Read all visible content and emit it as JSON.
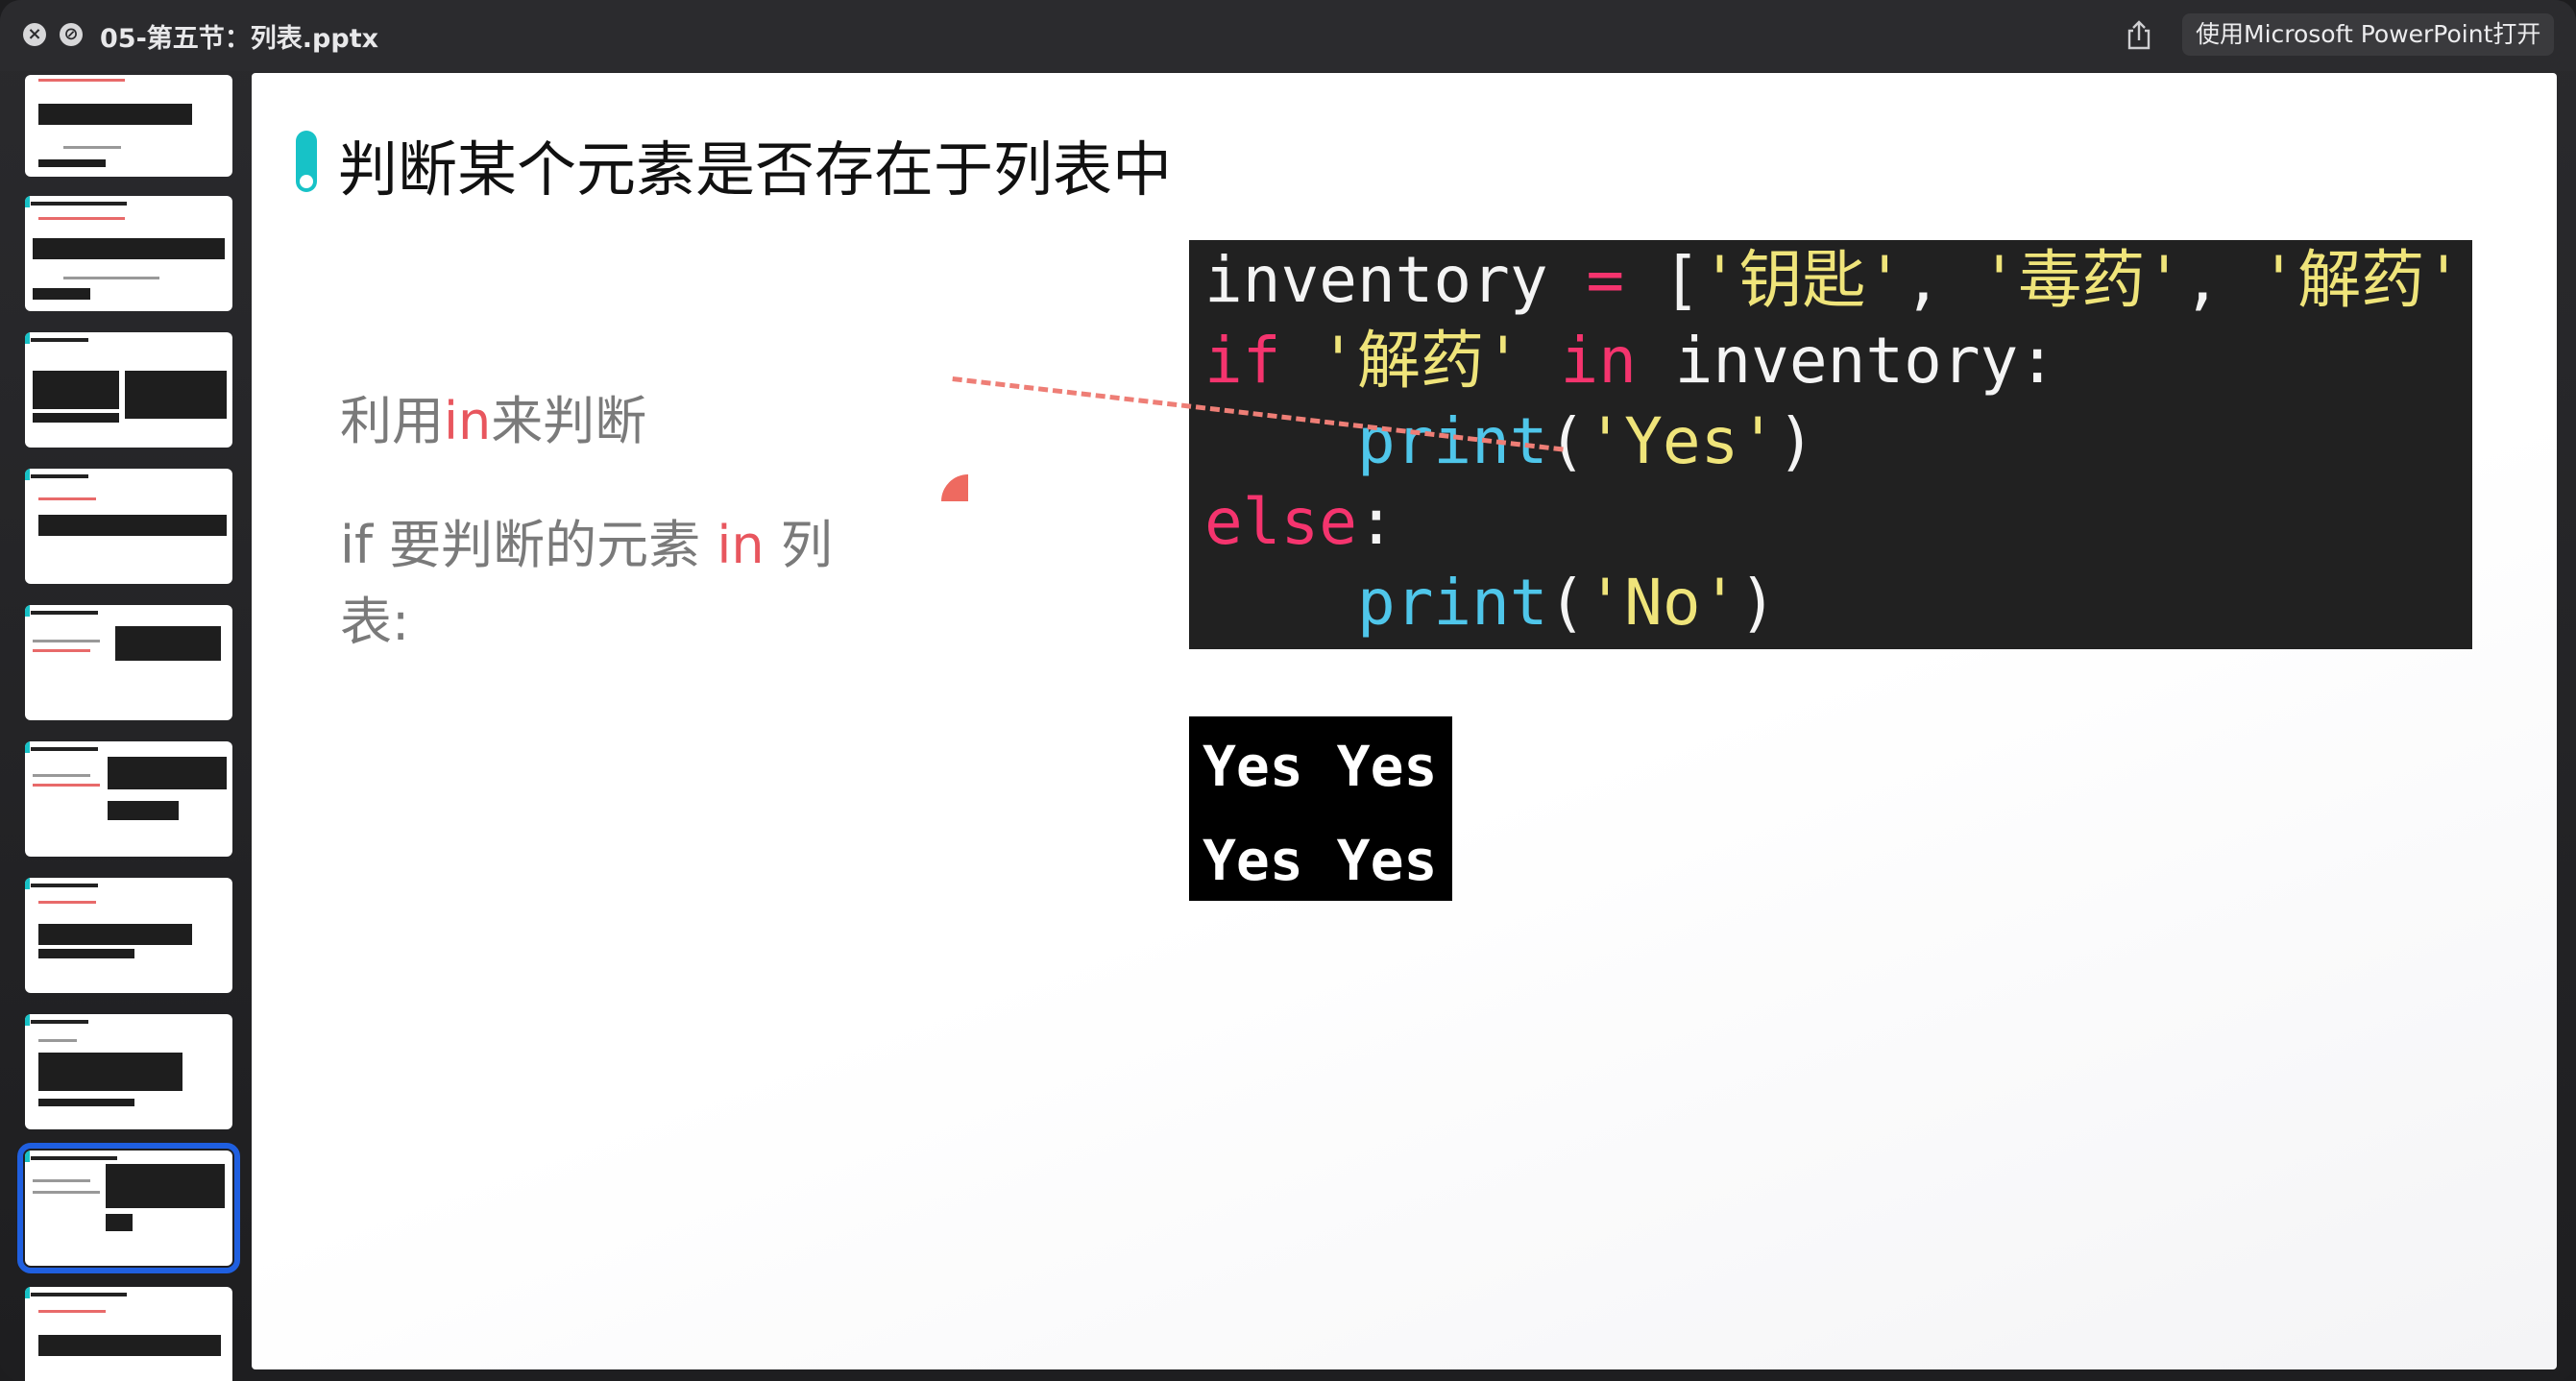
{
  "window": {
    "title": "05-第五节：列表.pptx",
    "open_button": "使用Microsoft PowerPoint打开"
  },
  "slide": {
    "title": "判断某个元素是否存在于列表中",
    "bullet1": {
      "pre": "利用",
      "kw": "in",
      "post": "来判断"
    },
    "bullet2": {
      "line1_pre": "if 要判断的元素 ",
      "kw": "in",
      "line1_post": " 列",
      "line2": "表:"
    },
    "code": {
      "l1": {
        "a": "inventory ",
        "eq": "=",
        "b": " [",
        "s1": "'钥匙'",
        "c1": ", ",
        "s2": "'毒药'",
        "c2": ", ",
        "s3": "'解药'"
      },
      "l2": {
        "if": "if",
        "sp": " ",
        "str": "'解药'",
        "in": " in",
        "rest": " inventory:"
      },
      "l3": {
        "indent": "    ",
        "fn": "print",
        "open": "(",
        "str": "'Yes'",
        "close": ")"
      },
      "l4": {
        "kw": "else",
        "colon": ":"
      },
      "l5": {
        "indent": "    ",
        "fn": "print",
        "open": "(",
        "str": "'No'",
        "close": ")"
      }
    },
    "output": {
      "row1": "Yes Yes",
      "row2": "Yes Yes"
    }
  }
}
